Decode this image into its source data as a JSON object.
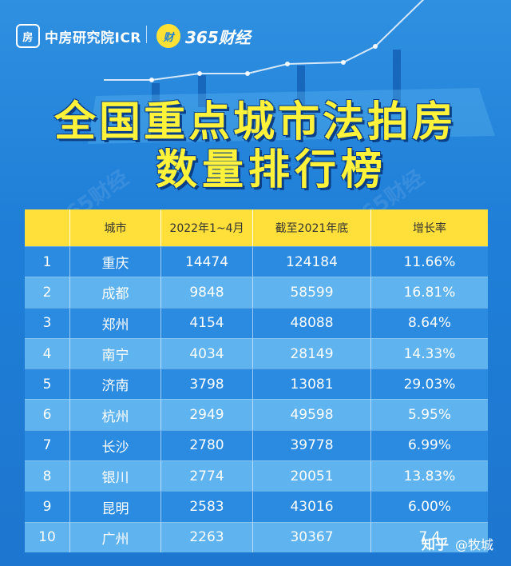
{
  "header": {
    "logo_left": "中房研究院ICR",
    "logo_left_mark": "房",
    "logo_right": "365财经",
    "logo_right_mark": "财"
  },
  "title": {
    "line1": "全国重点城市法拍房",
    "line2": "数量排行榜"
  },
  "watermark": "365财经",
  "table": {
    "headers": [
      "",
      "城市",
      "2022年1~4月",
      "截至2021年底",
      "增长率"
    ],
    "rows": [
      {
        "rank": "1",
        "city": "重庆",
        "y2022": "14474",
        "y2021": "124184",
        "growth": "11.66%"
      },
      {
        "rank": "2",
        "city": "成都",
        "y2022": "9848",
        "y2021": "58599",
        "growth": "16.81%"
      },
      {
        "rank": "3",
        "city": "郑州",
        "y2022": "4154",
        "y2021": "48088",
        "growth": "8.64%"
      },
      {
        "rank": "4",
        "city": "南宁",
        "y2022": "4034",
        "y2021": "28149",
        "growth": "14.33%"
      },
      {
        "rank": "5",
        "city": "济南",
        "y2022": "3798",
        "y2021": "13081",
        "growth": "29.03%"
      },
      {
        "rank": "6",
        "city": "杭州",
        "y2022": "2949",
        "y2021": "49598",
        "growth": "5.95%"
      },
      {
        "rank": "7",
        "city": "长沙",
        "y2022": "2780",
        "y2021": "39778",
        "growth": "6.99%"
      },
      {
        "rank": "8",
        "city": "银川",
        "y2022": "2774",
        "y2021": "20051",
        "growth": "13.83%"
      },
      {
        "rank": "9",
        "city": "昆明",
        "y2022": "2583",
        "y2021": "43016",
        "growth": "6.00%"
      },
      {
        "rank": "10",
        "city": "广州",
        "y2022": "2263",
        "y2021": "30367",
        "growth": "7.4"
      }
    ]
  },
  "footer": {
    "platform": "知乎",
    "author": "@牧城"
  },
  "colors": {
    "background": "#1f7fd8",
    "header_row": "#ffe03a",
    "row_dark": "#2a8be0",
    "row_light": "#5fb3ee",
    "title_yellow": "#fff23a"
  }
}
